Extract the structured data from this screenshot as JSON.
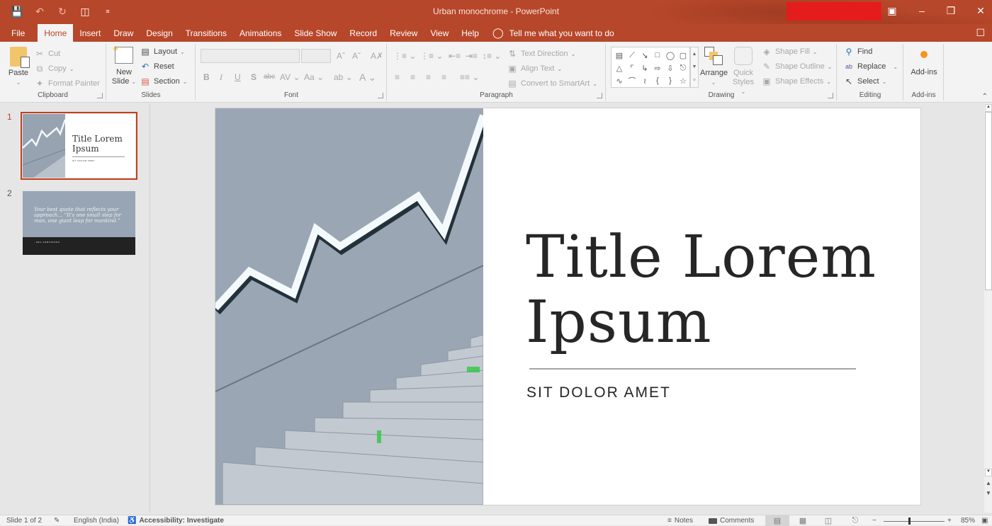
{
  "window": {
    "title": "Urban monochrome  -  PowerPoint",
    "controls": [
      "restore-ribbon-display",
      "minimize",
      "restore",
      "close"
    ]
  },
  "qat": {
    "items": [
      "save",
      "undo",
      "redo",
      "present-from-beginning",
      "customize"
    ]
  },
  "tabs": [
    {
      "label": "File"
    },
    {
      "label": "Home",
      "active": true
    },
    {
      "label": "Insert"
    },
    {
      "label": "Draw"
    },
    {
      "label": "Design"
    },
    {
      "label": "Transitions"
    },
    {
      "label": "Animations"
    },
    {
      "label": "Slide Show"
    },
    {
      "label": "Record"
    },
    {
      "label": "Review"
    },
    {
      "label": "View"
    },
    {
      "label": "Help"
    }
  ],
  "tell_me": "Tell me what you want to do",
  "ribbon": {
    "clipboard": {
      "label": "Clipboard",
      "paste": "Paste",
      "cut": "Cut",
      "copy": "Copy",
      "format_painter": "Format Painter"
    },
    "slides": {
      "label": "Slides",
      "new_slide_1": "New",
      "new_slide_2": "Slide",
      "layout": "Layout",
      "reset": "Reset",
      "section": "Section"
    },
    "font": {
      "label": "Font",
      "font_name": "",
      "font_size": ""
    },
    "paragraph": {
      "label": "Paragraph",
      "text_direction": "Text Direction",
      "align_text": "Align Text",
      "convert_smartart": "Convert to SmartArt"
    },
    "drawing": {
      "label": "Drawing",
      "arrange": "Arrange",
      "quick_styles_1": "Quick",
      "quick_styles_2": "Styles",
      "shape_fill": "Shape Fill",
      "shape_outline": "Shape Outline",
      "shape_effects": "Shape Effects"
    },
    "editing": {
      "label": "Editing",
      "find": "Find",
      "replace": "Replace",
      "select": "Select"
    },
    "addins": {
      "label": "Add-ins",
      "button": "Add-ins"
    }
  },
  "thumbnails": [
    {
      "number": "1",
      "title": "Title Lorem Ipsum",
      "subtitle": "SIT DOLOR AMET",
      "selected": true
    },
    {
      "number": "2",
      "quote": "Your best quote that reflects your approach… “It's one small step for man, one giant leap for mankind.”",
      "attribution": "- NEIL ARMSTRONG"
    }
  ],
  "slide": {
    "title_line1": "Title Lorem",
    "title_line2": "Ipsum",
    "subtitle": "SIT DOLOR AMET"
  },
  "status": {
    "slide_count": "Slide 1 of 2",
    "language": "English (India)",
    "accessibility": "Accessibility: Investigate",
    "notes": "Notes",
    "comments": "Comments",
    "zoom": "85%",
    "zoom_percent": 85
  },
  "colors": {
    "accent": "#b7472a",
    "selection": "#c43e1c"
  }
}
